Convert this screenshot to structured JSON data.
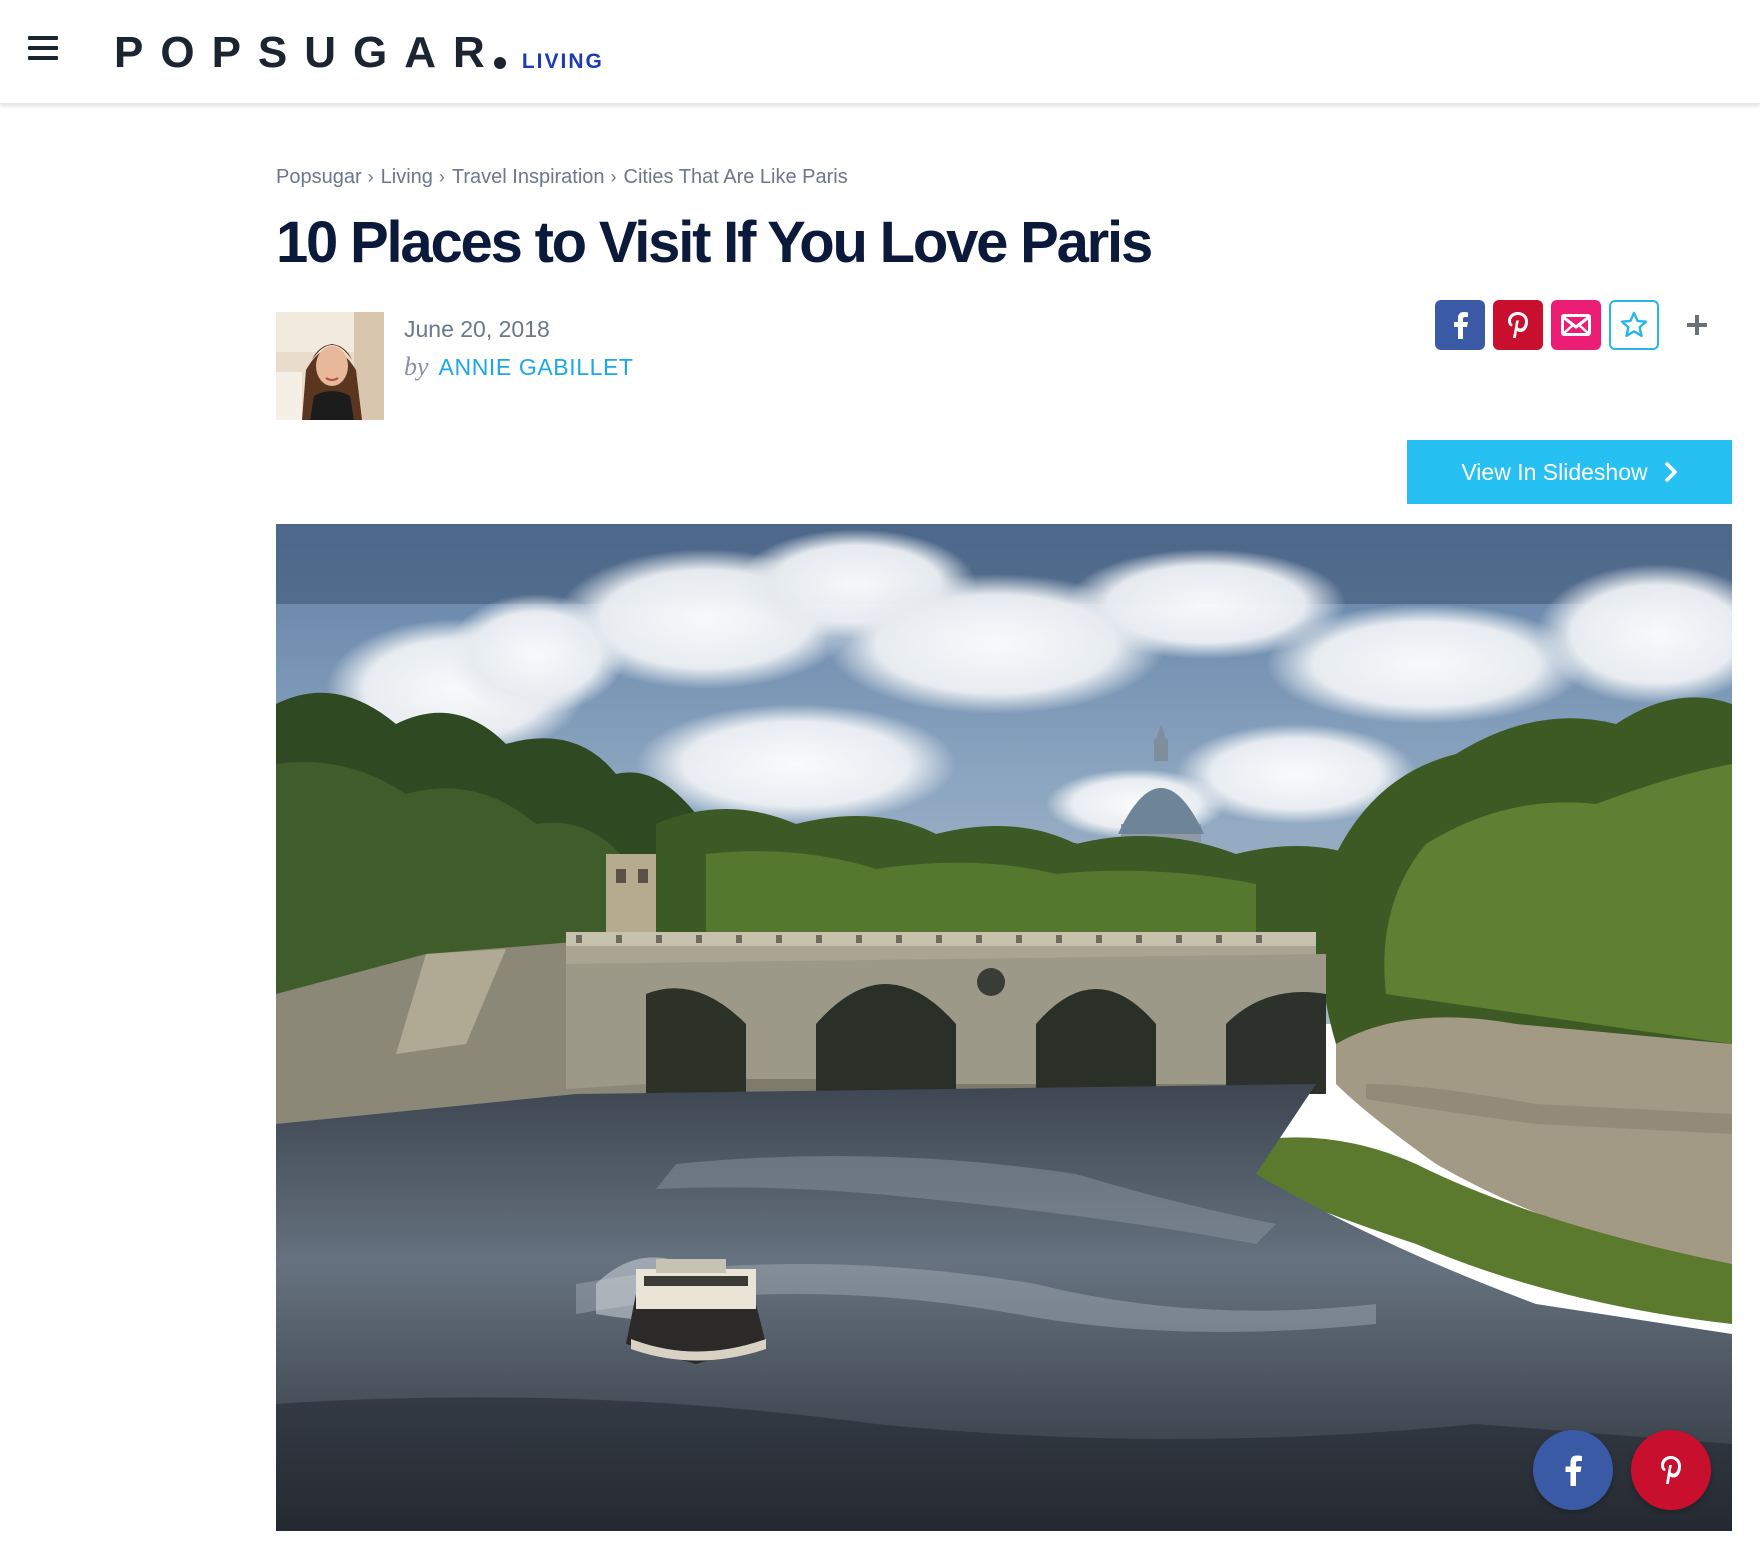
{
  "header": {
    "logo_text": "POPSUGAR",
    "section_label": "LIVING"
  },
  "breadcrumb": {
    "items": [
      "Popsugar",
      "Living",
      "Travel Inspiration",
      "Cities That Are Like Paris"
    ],
    "separator": "›"
  },
  "article": {
    "title": "10 Places to Visit If You Love Paris",
    "date": "June 20, 2018",
    "by_label": "by",
    "author": "ANNIE GABILLET"
  },
  "share": {
    "icons": [
      "facebook-icon",
      "pinterest-icon",
      "email-icon",
      "star-icon",
      "plus-icon"
    ]
  },
  "slideshow_button": {
    "label": "View In Slideshow"
  },
  "colors": {
    "brand_dark": "#1d2431",
    "section_blue": "#1a3bb3",
    "title_navy": "#0b1a3a",
    "link_blue": "#1aa8e8",
    "slideshow_cyan": "#27c0f2",
    "facebook": "#3a5aa6",
    "pinterest": "#c8102e",
    "email_pink": "#ec1d75"
  }
}
